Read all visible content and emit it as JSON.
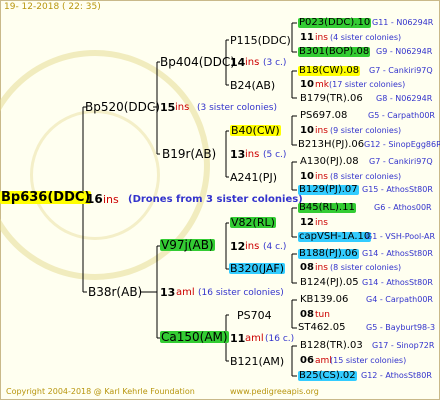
{
  "header": {
    "date_text": "19-  12-2018  ( 22: 35)"
  },
  "footer": {
    "copyright": "Copyright 2004-2018 @ Karl Kehrle Foundation",
    "url": "www.pedigreeapis.org"
  },
  "colors": {
    "green": "#33cc33",
    "yellow": "#ffff00",
    "cyan": "#33ccff",
    "inbreeding": "#cc0000",
    "siblings": "#3333cc",
    "lines": "#000000"
  },
  "root": {
    "name": "Bp636(DDC)",
    "ins": "16",
    "ins_label": "ins",
    "drones": "(Drones from 3 sister colonies)"
  },
  "gen1": [
    {
      "name": "Bp520(DDC)",
      "ins": "15",
      "ins_label": "ins",
      "sisters": "(3 sister colonies)"
    },
    {
      "name": "B38r(AB)",
      "ins": "13",
      "ins_label": "aml",
      "sisters": "(16 sister colonies)"
    }
  ],
  "gen2": [
    {
      "name": "Bp404(DDC)",
      "ins": "14",
      "ins_label": "ins",
      "sisters": "(3 c.)"
    },
    {
      "name": "B19r(AB)",
      "ins": "13",
      "ins_label": "ins",
      "sisters": "(5 c.)"
    },
    {
      "name": "V97j(AB)",
      "ins": "12",
      "ins_label": "ins",
      "sisters": "(4 c.)"
    },
    {
      "name": "Ca150(AM)",
      "ins": "11",
      "ins_label": "aml",
      "sisters": "(16 c.)"
    }
  ],
  "gen3": [
    {
      "name": "P115(DDC)"
    },
    {
      "name": "B24(AB)"
    },
    {
      "name": "B40(CW)"
    },
    {
      "name": "A241(PJ)"
    },
    {
      "name": "V82(RL)",
      "ins": "12",
      "ins_label": "ins"
    },
    {
      "name": "B320(JAF)",
      "ins": "08",
      "ins_label": "ins",
      "sisters": "(8 sister colonies)"
    },
    {
      "name": "PS704",
      "ins": "08",
      "ins_label": "tun"
    },
    {
      "name": "B121(AM)",
      "ins": "06",
      "ins_label": "aml",
      "sisters": "(15 sister colonies)"
    }
  ],
  "gen4": [
    {
      "name": "P023(DDC).10",
      "info": "G11 - N06294R"
    },
    {
      "ins": "11",
      "ins_label": "ins",
      "sisters": "(4 sister colonies)"
    },
    {
      "name": "B301(BOP).08",
      "info": "G9 - N06294R"
    },
    {
      "name": "B18(CW).08",
      "info": "G7 - Cankiri97Q"
    },
    {
      "ins": "10",
      "ins_label": "mk",
      "sisters": "(17 sister colonies)"
    },
    {
      "name": "B179(TR).06",
      "info": "G8 - N06294R"
    },
    {
      "name": "PS697.08",
      "info": "G5 - Carpath00R"
    },
    {
      "ins": "10",
      "ins_label": "ins",
      "sisters": "(9 sister colonies)"
    },
    {
      "name": "B213H(PJ).06",
      "info": "G12 - SinopEgg86R"
    },
    {
      "name": "A130(PJ).08",
      "info": "G7 - Cankiri97Q"
    },
    {
      "ins": "10",
      "ins_label": "ins",
      "sisters": "(8 sister colonies)"
    },
    {
      "name": "B129(PJ).07",
      "info": "G15 - AthosSt80R"
    },
    {
      "name": "B45(RL).11",
      "info": "G6 - Athos00R"
    },
    {
      "ins": "12",
      "ins_label": "ins"
    },
    {
      "name": "capVSH-1A.10",
      "info": "G1 - VSH-Pool-AR"
    },
    {
      "name": "B188(PJ).06",
      "info": "G14 - AthosSt80R"
    },
    {
      "name": "B124(PJ).05",
      "info": "G14 - AthosSt80R"
    },
    {
      "name": "KB139.06",
      "info": "G4 - Carpath00R"
    },
    {
      "name": "ST462.05",
      "info": "G5 - Bayburt98-3"
    },
    {
      "name": "B128(TR).03",
      "info": "G17 - Sinop72R"
    },
    {
      "name": "B25(CS).02",
      "info": "G12 - AthosSt80R"
    }
  ]
}
